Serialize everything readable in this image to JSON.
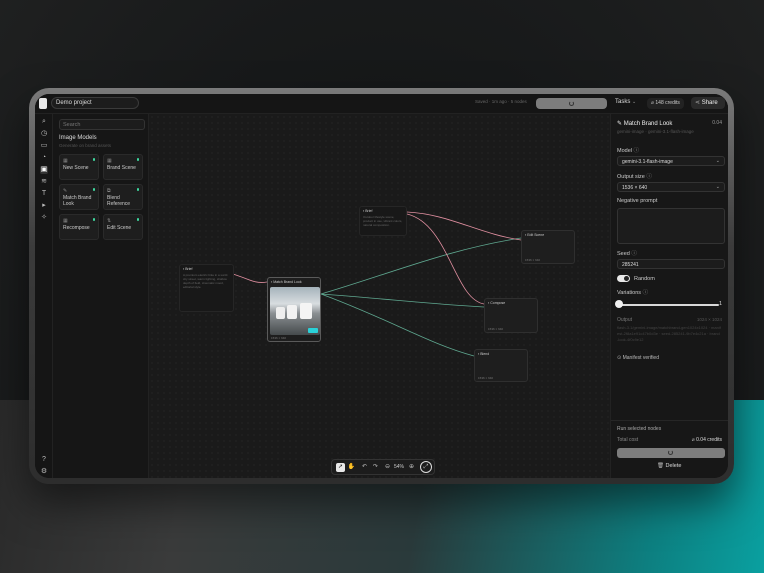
{
  "project": {
    "name": "Demo project"
  },
  "topbar": {
    "saved_text": "Saved · 1m ago · 5 nodes",
    "tasks_label": "Tasks",
    "credits_label": "148 credits",
    "share_label": "Share"
  },
  "left_panel": {
    "search_placeholder": "Search",
    "section_title": "Image Models",
    "section_subtitle": "Generate on brand assets",
    "tiles": [
      {
        "label": "New Scene"
      },
      {
        "label": "Brand Scene"
      },
      {
        "label": "Match Brand Look"
      },
      {
        "label": "Blend Reference"
      },
      {
        "label": "Recompose"
      },
      {
        "label": "Edit Scene"
      }
    ]
  },
  "canvas": {
    "zoom": "54%",
    "nodes": [
      {
        "title": "Brief",
        "body": "A premium electric bike in a sunlit city street, warm lighting, shallow depth of field, cinematic mood, editorial style."
      },
      {
        "title": "Match Brand Look",
        "footer": "1536 × 640"
      },
      {
        "title": "Brief",
        "body": "Outdoor lifestyle scene, product in use, vibrant colors, natural composition."
      },
      {
        "title": "Edit Scene",
        "footer": "1536 × 640"
      },
      {
        "title": "Compose",
        "footer": "1536 × 640"
      },
      {
        "title": "Blend",
        "footer": "1536 × 640"
      }
    ]
  },
  "right_panel": {
    "node_title": "Match Brand Look",
    "node_cost": "0.04",
    "node_subtitle": "gemini-image · gemini-3.1-flash-image",
    "model_label": "Model",
    "model_value": "gemini-3.1-flash-image",
    "output_size_label": "Output size",
    "output_size_value": "1536 × 640",
    "negative_prompt_label": "Negative prompt",
    "seed_label": "Seed",
    "seed_value": "285241",
    "random_label": "Random",
    "variations_label": "Variations",
    "variations_value": "1",
    "variations_fraction": 0,
    "output_label": "Output",
    "output_dims": "1024 × 1024",
    "output_details": "flash-3.1/gemini-image/matchbrand-gen1024x1024 · manifest-2f8a1e91c47b0d3e · seed-285241-9b7e4c21a · brand-look-4f0c9e12",
    "manifest_label": "Manifest verified",
    "run_selected_label": "Run selected nodes",
    "total_cost_label": "Total cost",
    "total_cost_value": "0.04 credits",
    "delete_label": "Delete"
  },
  "colors": {
    "accent_green": "#3fd9a0",
    "edge_pink": "#e08fa0",
    "edge_green": "#5fa890"
  }
}
